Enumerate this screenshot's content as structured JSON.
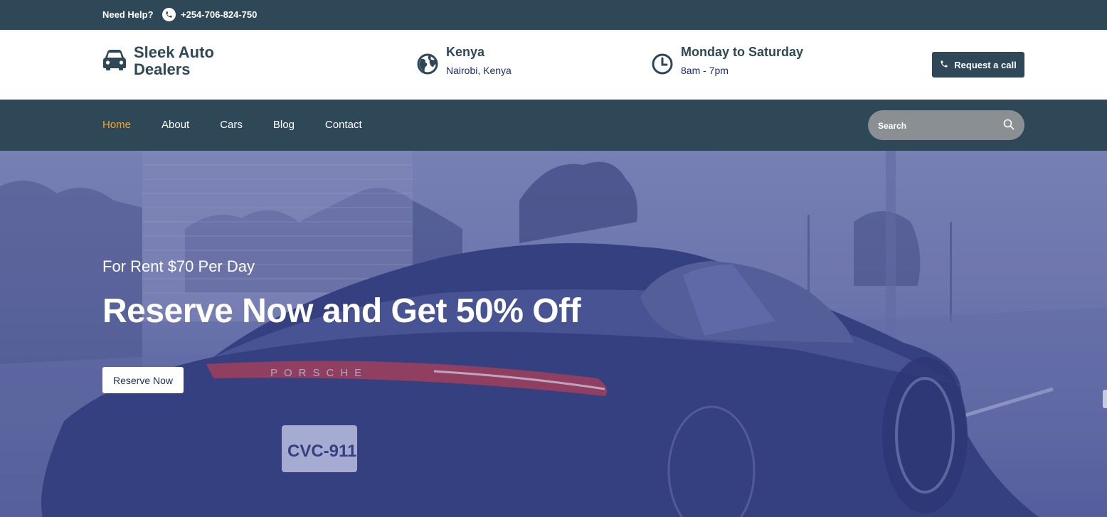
{
  "topbar": {
    "help_label": "Need Help?",
    "phone": "+254-706-824-750",
    "phone_icon": "phone-icon"
  },
  "brand": {
    "name": "Sleek Auto Dealers",
    "icon": "car-icon"
  },
  "location": {
    "title": "Kenya",
    "subtitle": "Nairobi, Kenya",
    "icon": "globe-icon"
  },
  "hours": {
    "title": "Monday to Saturday",
    "subtitle": "8am - 7pm",
    "icon": "clock-icon"
  },
  "request_call": {
    "label": "Request a call",
    "icon": "phone-icon"
  },
  "nav": {
    "items": [
      {
        "label": "Home",
        "active": true
      },
      {
        "label": "About",
        "active": false
      },
      {
        "label": "Cars",
        "active": false
      },
      {
        "label": "Blog",
        "active": false
      },
      {
        "label": "Contact",
        "active": false
      }
    ],
    "active_color": "#f5a623"
  },
  "search": {
    "placeholder": "Search",
    "icon": "search-icon"
  },
  "hero": {
    "kicker": "For Rent $70 Per Day",
    "headline": "Reserve Now and Get 50% Off",
    "cta_label": "Reserve Now",
    "car_brand": "PORSCHE",
    "plate": "CVC-911"
  },
  "colors": {
    "primary": "#2f4858",
    "accent_text": "#1b2a7a",
    "hero_tint": "#5e6aa3"
  }
}
